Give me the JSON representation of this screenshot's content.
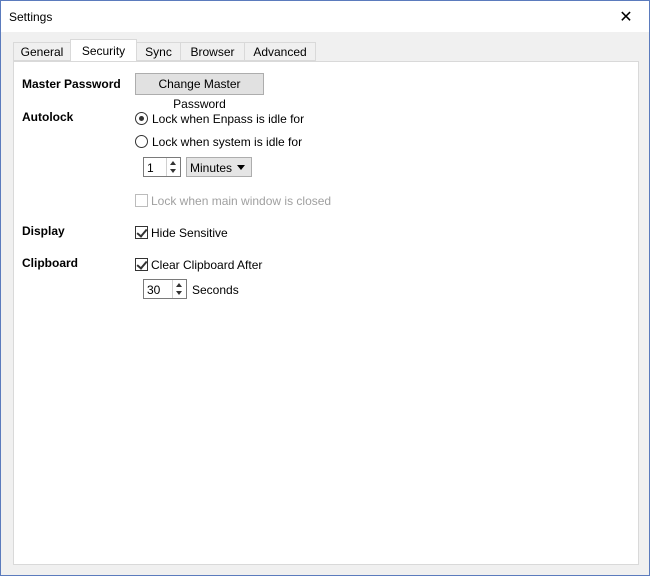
{
  "window": {
    "title": "Settings"
  },
  "tabs": [
    {
      "label": "General",
      "active": false
    },
    {
      "label": "Security",
      "active": true
    },
    {
      "label": "Sync",
      "active": false
    },
    {
      "label": "Browser",
      "active": false
    },
    {
      "label": "Advanced",
      "active": false
    }
  ],
  "security": {
    "master_password": {
      "label": "Master Password",
      "button_label": "Change Master Password"
    },
    "autolock": {
      "label": "Autolock",
      "option_idle_enpass": {
        "label": "Lock when Enpass is idle for",
        "selected": true
      },
      "option_idle_system": {
        "label": "Lock when system is idle for",
        "selected": false
      },
      "idle_value": "1",
      "idle_unit": "Minutes",
      "lock_on_close": {
        "label": "Lock when main window is closed",
        "checked": false,
        "disabled": true
      }
    },
    "display": {
      "label": "Display",
      "hide_sensitive": {
        "label": "Hide Sensitive",
        "checked": true
      }
    },
    "clipboard": {
      "label": "Clipboard",
      "clear_after": {
        "label": "Clear Clipboard After",
        "checked": true
      },
      "seconds_value": "30",
      "seconds_label": "Seconds"
    }
  }
}
